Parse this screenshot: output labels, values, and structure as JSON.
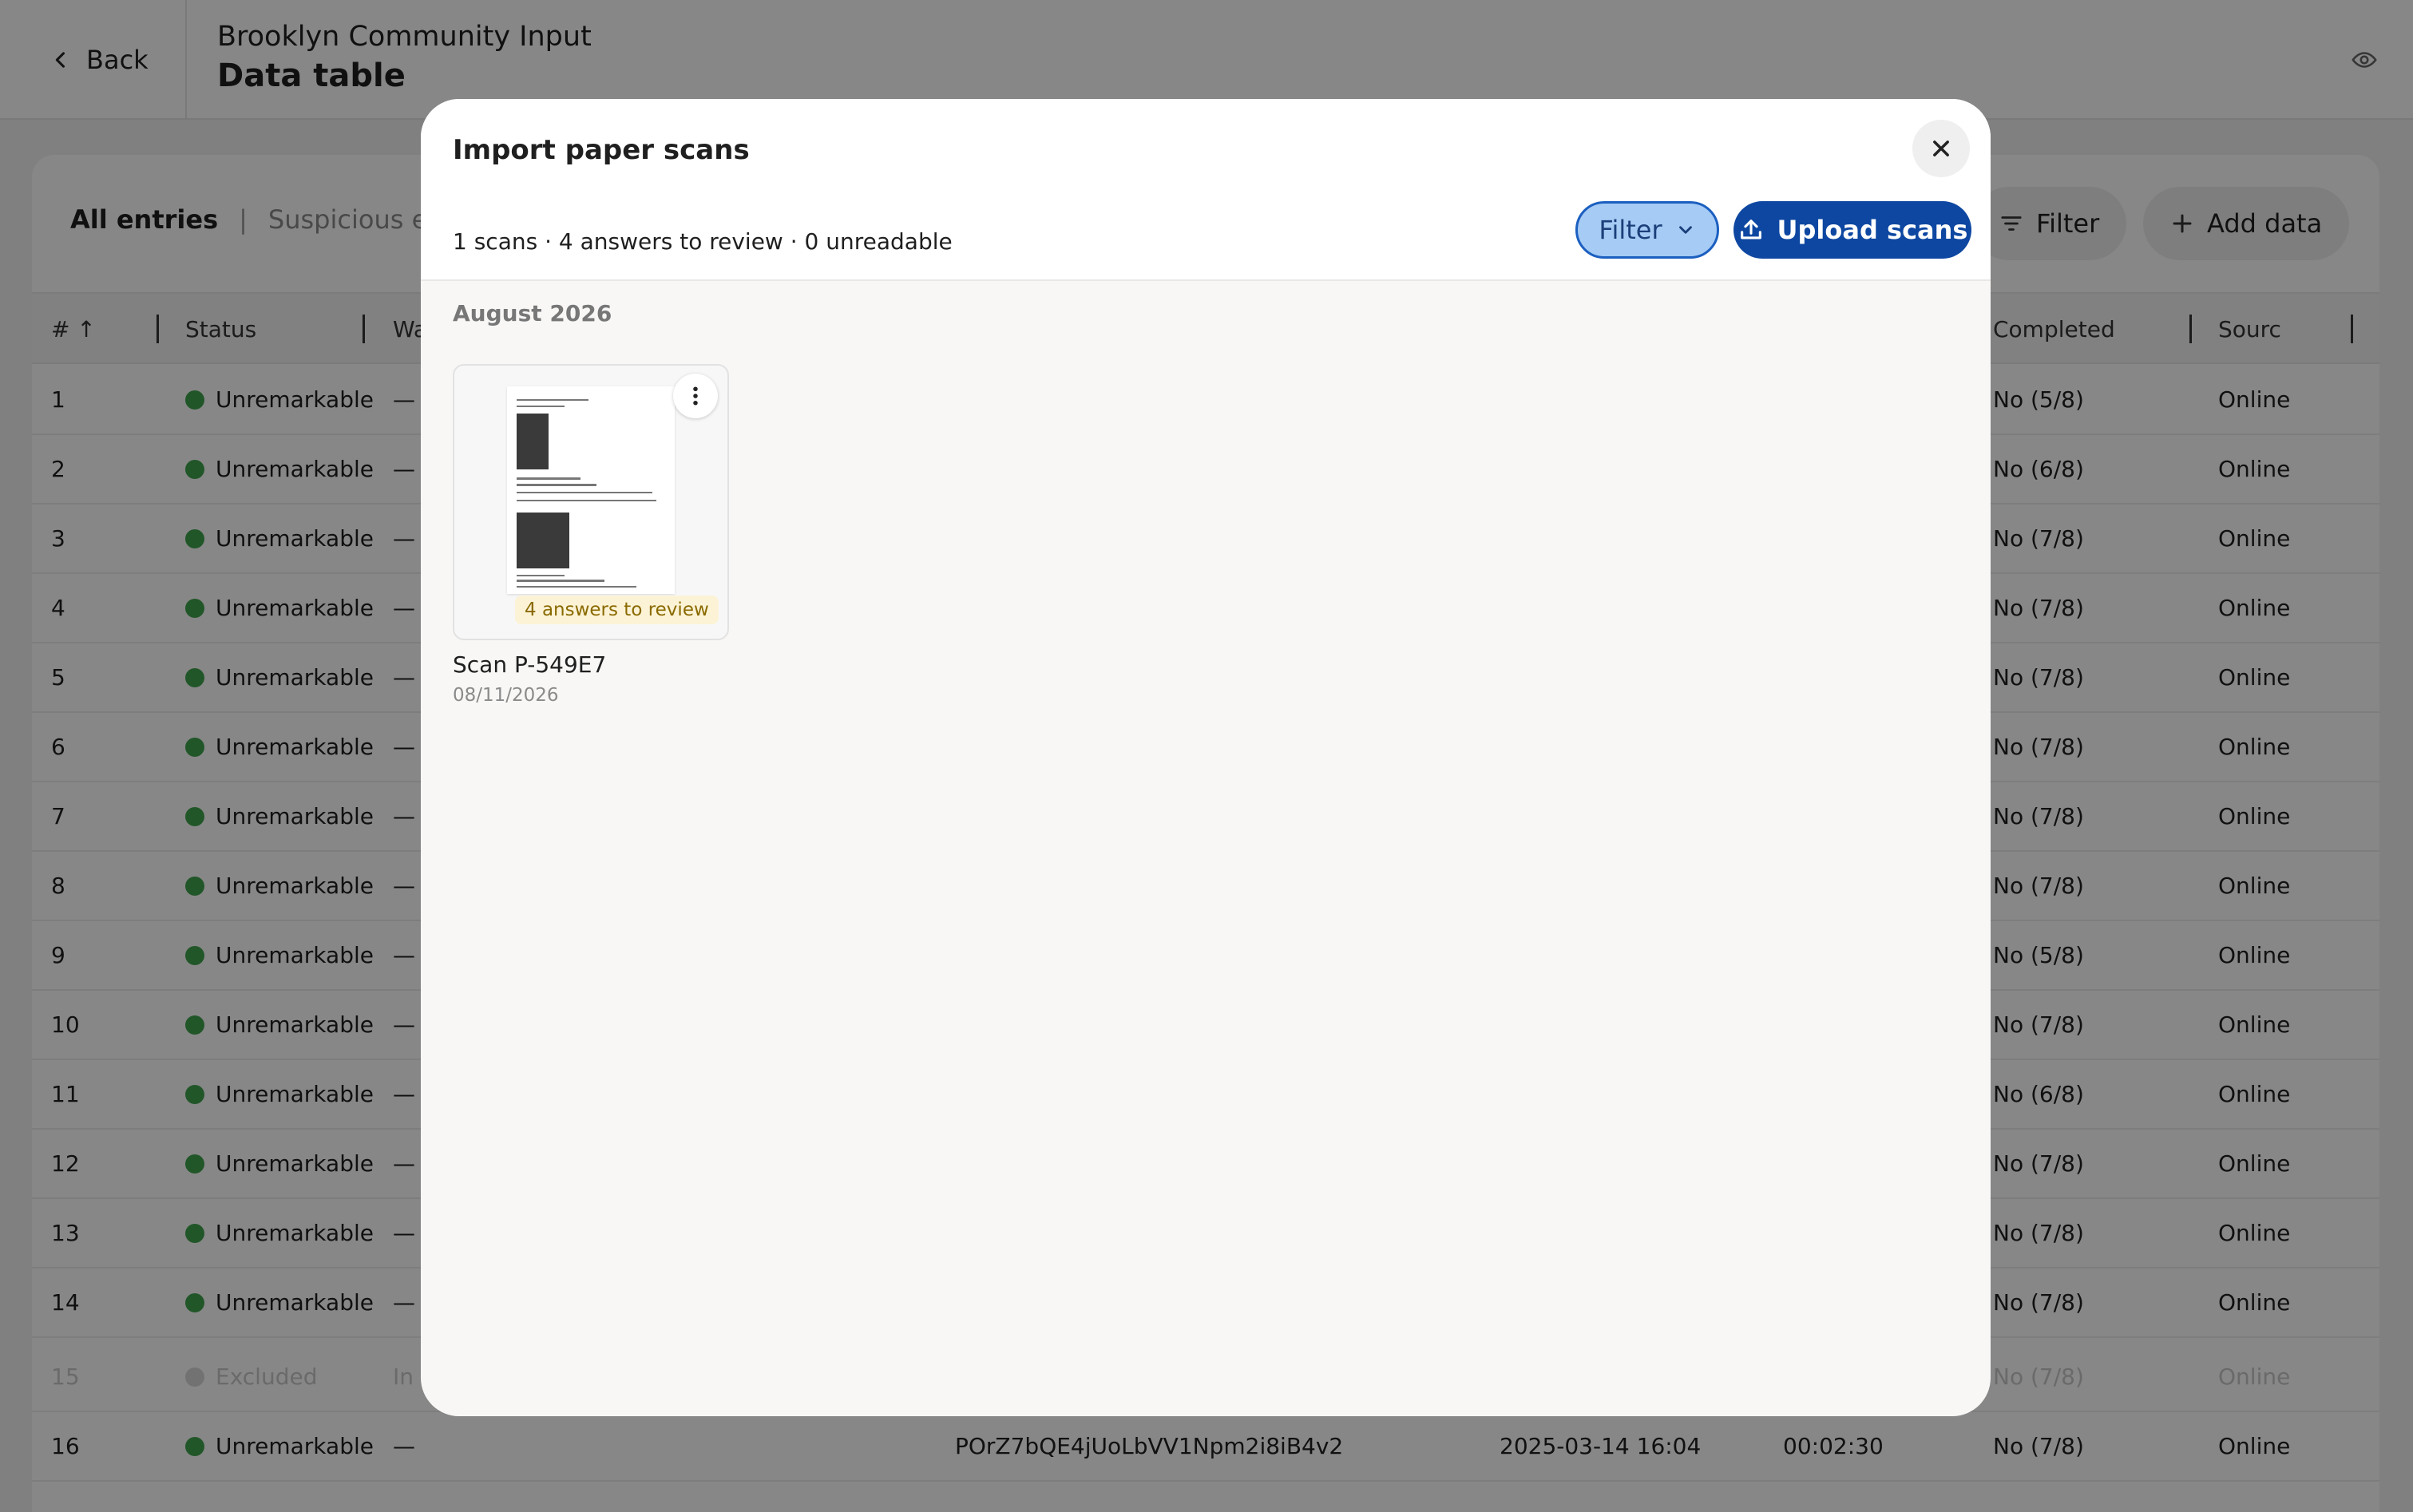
{
  "header": {
    "back_label": "Back",
    "project": "Brooklyn Community Input",
    "title": "Data table"
  },
  "toolbar": {
    "tab_all": "All entries",
    "tab_suspicious": "Suspicious entri",
    "filter_label": "Filter",
    "add_label": "Add data"
  },
  "table": {
    "headers": {
      "num": "#",
      "status": "Status",
      "wa": "Wa",
      "completed": "Completed",
      "source": "Sourc"
    },
    "rows": [
      {
        "n": "1",
        "status": "Unremarkable",
        "wa": "—",
        "completed": "No (5/8)",
        "source": "Online"
      },
      {
        "n": "2",
        "status": "Unremarkable",
        "wa": "—",
        "completed": "No (6/8)",
        "source": "Online"
      },
      {
        "n": "3",
        "status": "Unremarkable",
        "wa": "—",
        "completed": "No (7/8)",
        "source": "Online"
      },
      {
        "n": "4",
        "status": "Unremarkable",
        "wa": "—",
        "completed": "No (7/8)",
        "source": "Online"
      },
      {
        "n": "5",
        "status": "Unremarkable",
        "wa": "—",
        "completed": "No (7/8)",
        "source": "Online"
      },
      {
        "n": "6",
        "status": "Unremarkable",
        "wa": "—",
        "completed": "No (7/8)",
        "source": "Online"
      },
      {
        "n": "7",
        "status": "Unremarkable",
        "wa": "—",
        "completed": "No (7/8)",
        "source": "Online"
      },
      {
        "n": "8",
        "status": "Unremarkable",
        "wa": "—",
        "completed": "No (7/8)",
        "source": "Online"
      },
      {
        "n": "9",
        "status": "Unremarkable",
        "wa": "—",
        "completed": "No (5/8)",
        "source": "Online"
      },
      {
        "n": "10",
        "status": "Unremarkable",
        "wa": "—",
        "completed": "No (7/8)",
        "source": "Online"
      },
      {
        "n": "11",
        "status": "Unremarkable",
        "wa": "—",
        "completed": "No (6/8)",
        "source": "Online"
      },
      {
        "n": "12",
        "status": "Unremarkable",
        "wa": "—",
        "completed": "No (7/8)",
        "source": "Online"
      },
      {
        "n": "13",
        "status": "Unremarkable",
        "wa": "—",
        "completed": "No (7/8)",
        "source": "Online"
      },
      {
        "n": "14",
        "status": "Unremarkable",
        "wa": "—",
        "completed": "No (7/8)",
        "source": "Online"
      },
      {
        "n": "15",
        "status": "Excluded",
        "wa": "In",
        "completed": "No (7/8)",
        "source": "Online",
        "excluded": true
      },
      {
        "n": "16",
        "status": "Unremarkable",
        "wa": "—",
        "id": "POrZ7bQE4jUoLbVV1Npm2i8iB4v2",
        "date": "2025-03-14 16:04",
        "duration": "00:02:30",
        "completed": "No (7/8)",
        "source": "Online"
      }
    ]
  },
  "modal": {
    "title": "Import paper scans",
    "summary": "1 scans · 4 answers to review · 0 unreadable",
    "filter_label": "Filter",
    "upload_label": "Upload scans",
    "month": "August 2026",
    "scan": {
      "name": "Scan P-549E7",
      "date": "08/11/2026",
      "badge": "4 answers to review"
    }
  }
}
